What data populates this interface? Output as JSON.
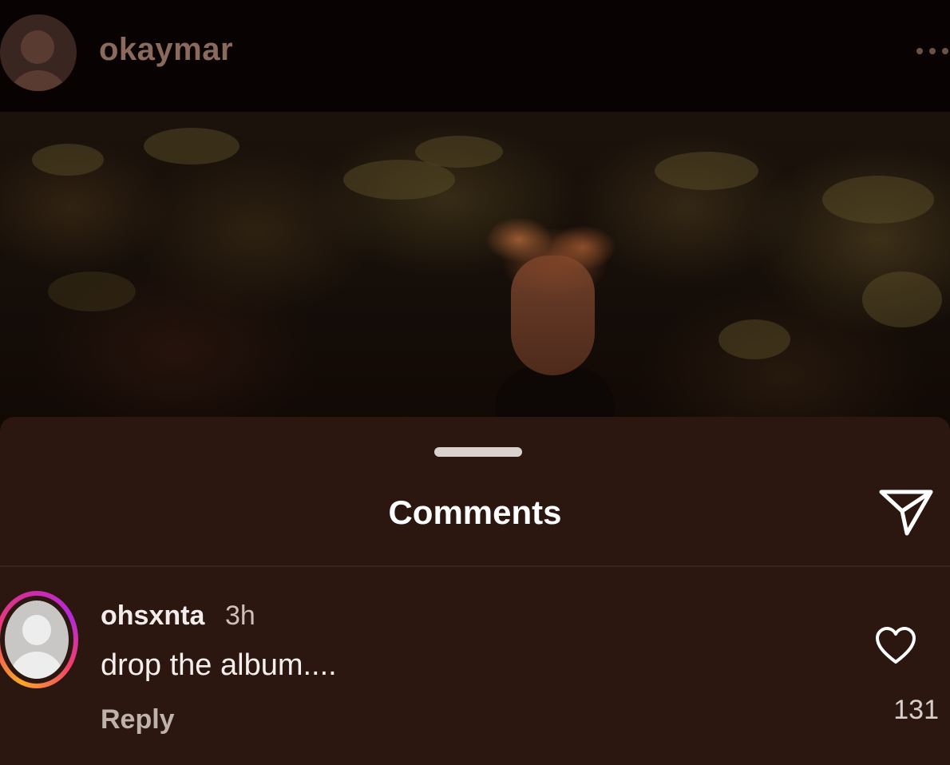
{
  "post": {
    "username": "okaymar",
    "more_label": "more-options-icon"
  },
  "comments_sheet": {
    "title": "Comments",
    "share_icon": "paper-plane-icon",
    "comments": [
      {
        "username": "ohsxnta",
        "time": "3h",
        "text": "drop the album....",
        "reply_label": "Reply",
        "like_icon": "heart-icon",
        "like_count": "131"
      }
    ]
  },
  "colors": {
    "sheet_background": "#2b1710",
    "story_ring_start": "#f9a825",
    "story_ring_mid": "#ef3f6a",
    "story_ring_end": "#b52ad8"
  }
}
